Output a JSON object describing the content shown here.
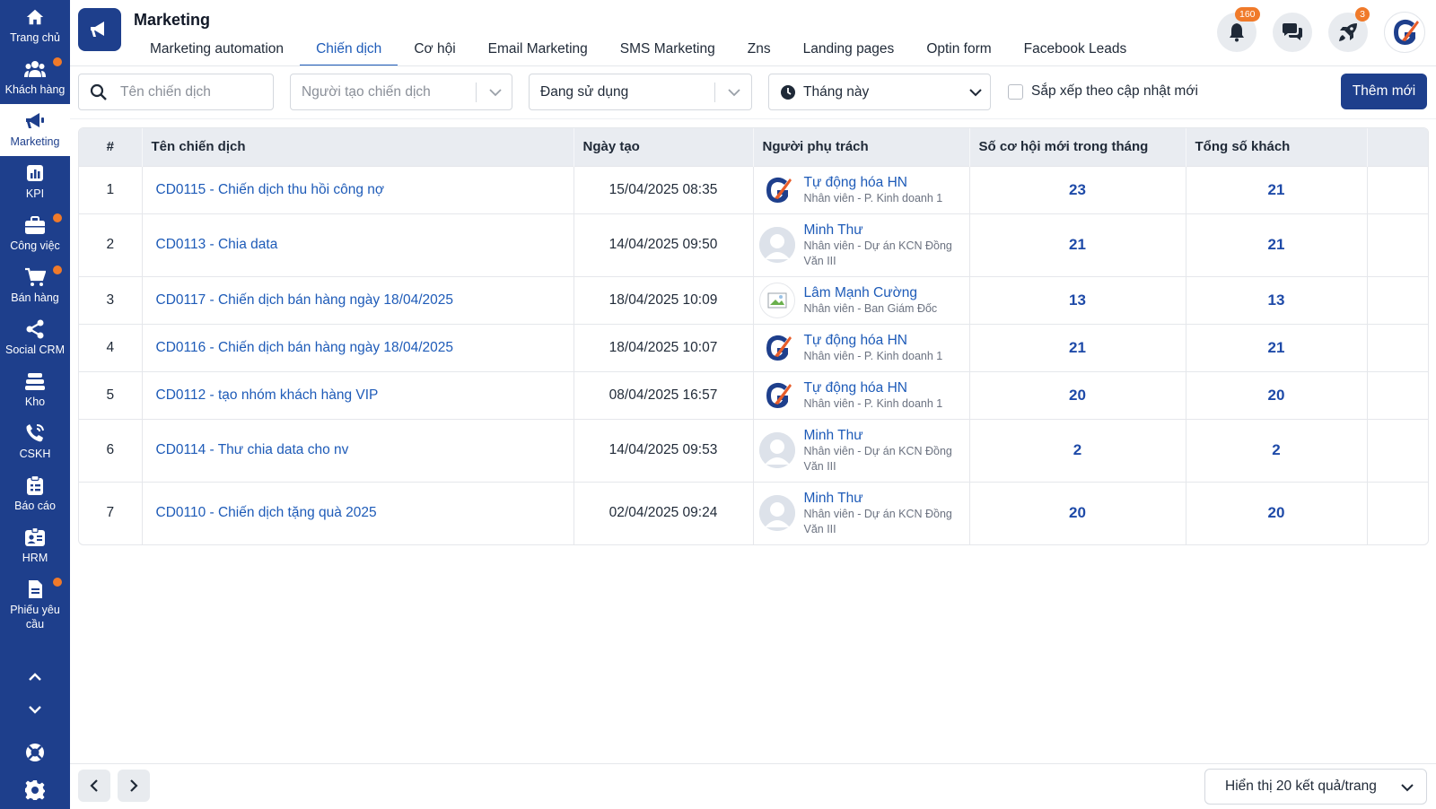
{
  "sidebar": {
    "items": [
      {
        "label": "Trang chủ",
        "icon": "home-icon",
        "dot": false
      },
      {
        "label": "Khách hàng",
        "icon": "customers-icon",
        "dot": true
      },
      {
        "label": "Marketing",
        "icon": "megaphone-icon",
        "dot": false,
        "active": true
      },
      {
        "label": "KPI",
        "icon": "kpi-chart-icon",
        "dot": false
      },
      {
        "label": "Công việc",
        "icon": "briefcase-icon",
        "dot": true
      },
      {
        "label": "Bán hàng",
        "icon": "cart-icon",
        "dot": true
      },
      {
        "label": "Social CRM",
        "icon": "share-icon",
        "dot": false
      },
      {
        "label": "Kho",
        "icon": "warehouse-icon",
        "dot": false
      },
      {
        "label": "CSKH",
        "icon": "phone-icon",
        "dot": false
      },
      {
        "label": "Báo cáo",
        "icon": "report-clipboard-icon",
        "dot": false
      },
      {
        "label": "HRM",
        "icon": "id-badge-icon",
        "dot": false
      },
      {
        "label": "Phiếu yêu cầu",
        "icon": "request-form-icon",
        "dot": true
      }
    ]
  },
  "header": {
    "title": "Marketing",
    "tabs": [
      {
        "label": "Marketing automation"
      },
      {
        "label": "Chiến dịch",
        "active": true
      },
      {
        "label": "Cơ hội"
      },
      {
        "label": "Email Marketing"
      },
      {
        "label": "SMS Marketing"
      },
      {
        "label": "Zns"
      },
      {
        "label": "Landing pages"
      },
      {
        "label": "Optin form"
      },
      {
        "label": "Facebook Leads"
      }
    ],
    "notifications_badge": "160",
    "rocket_badge": "3"
  },
  "filters": {
    "search_placeholder": "Tên chiến dịch",
    "creator_placeholder": "Người tạo chiến dịch",
    "status_value": "Đang sử dụng",
    "period_value": "Tháng này",
    "sort_label": "Sắp xếp theo cập nhật mới",
    "add_label": "Thêm mới"
  },
  "table": {
    "headers": {
      "num": "#",
      "name": "Tên chiến dịch",
      "created": "Ngày tạo",
      "owner": "Người phụ trách",
      "opportunities": "Số cơ hội mới trong tháng",
      "customers": "Tổng số khách"
    },
    "rows": [
      {
        "num": "1",
        "name": "CD0115 - Chiến dịch thu hồi công nợ",
        "created": "15/04/2025 08:35",
        "owner": "Tự động hóa HN",
        "role": "Nhân viên - P. Kinh doanh 1",
        "avatar": "brand-logo-avatar",
        "opportunities": "23",
        "customers": "21"
      },
      {
        "num": "2",
        "name": "CD0113 - Chia data",
        "created": "14/04/2025 09:50",
        "owner": "Minh Thư",
        "role": "Nhân viên - Dự án KCN Đồng Văn III",
        "avatar": "person-placeholder-avatar",
        "opportunities": "21",
        "customers": "21"
      },
      {
        "num": "3",
        "name": "CD0117 - Chiến dịch bán hàng ngày 18/04/2025",
        "created": "18/04/2025 10:09",
        "owner": "Lâm Mạnh Cường",
        "role": "Nhân viên - Ban Giám Đốc",
        "avatar": "broken-image-avatar",
        "opportunities": "13",
        "customers": "13"
      },
      {
        "num": "4",
        "name": "CD0116 - Chiến dịch bán hàng ngày 18/04/2025",
        "created": "18/04/2025 10:07",
        "owner": "Tự động hóa HN",
        "role": "Nhân viên - P. Kinh doanh 1",
        "avatar": "brand-logo-avatar",
        "opportunities": "21",
        "customers": "21"
      },
      {
        "num": "5",
        "name": "CD0112 - tạo nhóm khách hàng VIP",
        "created": "08/04/2025 16:57",
        "owner": "Tự động hóa HN",
        "role": "Nhân viên - P. Kinh doanh 1",
        "avatar": "brand-logo-avatar",
        "opportunities": "20",
        "customers": "20"
      },
      {
        "num": "6",
        "name": "CD0114 - Thư chia data cho nv",
        "created": "14/04/2025 09:53",
        "owner": "Minh Thư",
        "role": "Nhân viên - Dự án KCN Đồng Văn III",
        "avatar": "person-placeholder-avatar",
        "opportunities": "2",
        "customers": "2"
      },
      {
        "num": "7",
        "name": "CD0110 - Chiến dịch tặng quà 2025",
        "created": "02/04/2025 09:24",
        "owner": "Minh Thư",
        "role": "Nhân viên - Dự án KCN Đồng Văn III",
        "avatar": "person-placeholder-avatar",
        "opportunities": "20",
        "customers": "20"
      }
    ]
  },
  "footer": {
    "per_page": "Hiển thị 20 kết quả/trang"
  },
  "colors": {
    "sidebar": "#1e3f8c",
    "accent": "#1e5bb8",
    "badge": "#f07a2a",
    "brand_orange": "#e85d2a"
  }
}
